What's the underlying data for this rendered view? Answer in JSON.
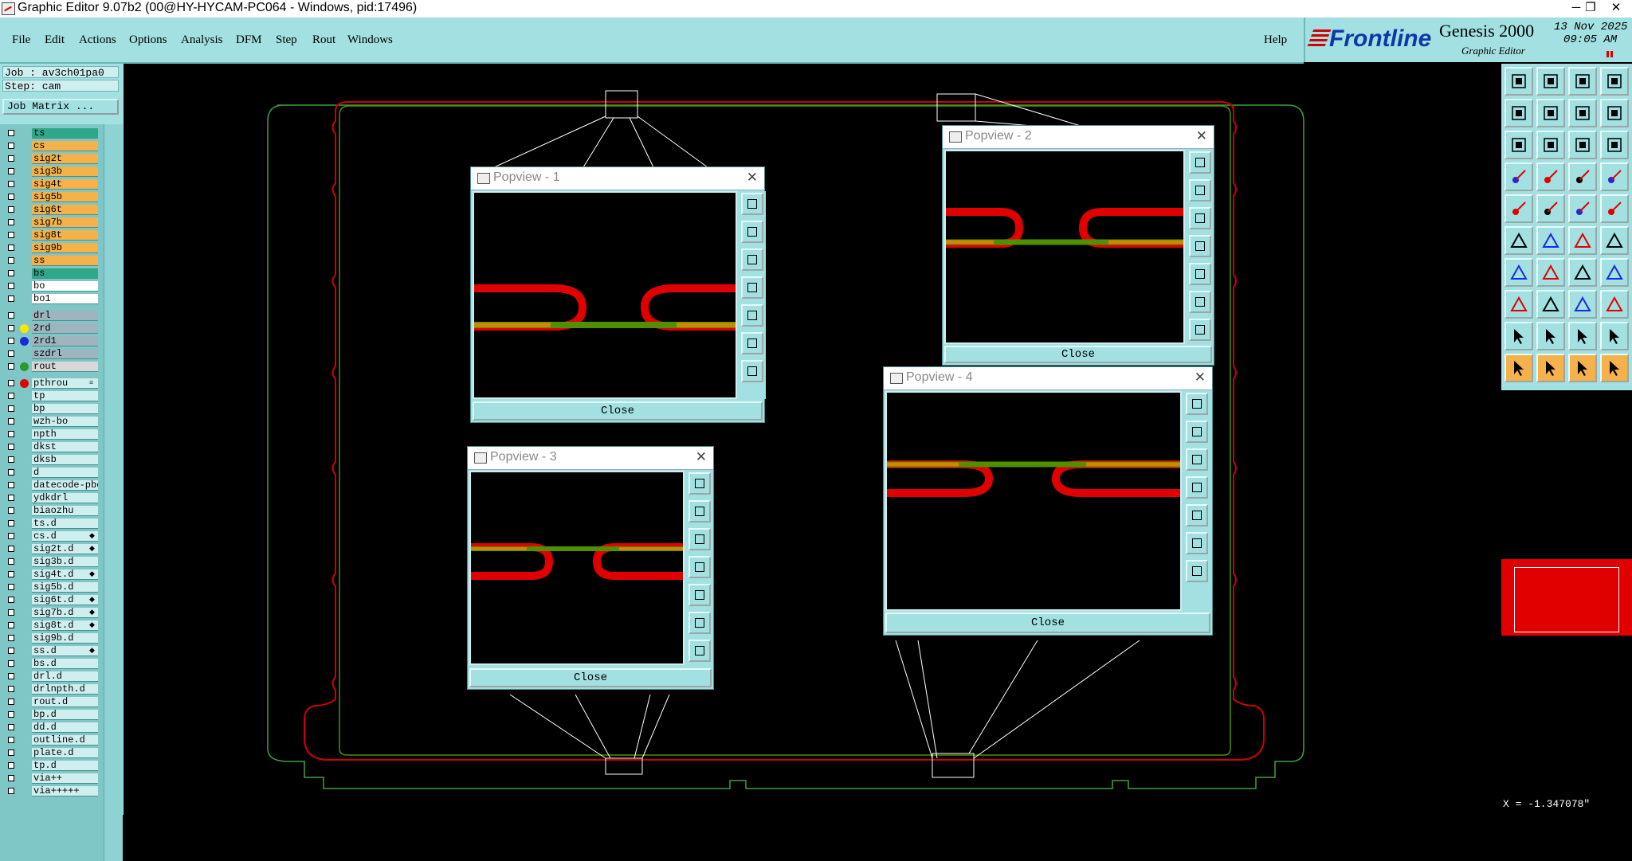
{
  "window": {
    "title": "Graphic Editor 9.07b2 (00@HY-HYCAM-PC064 - Windows, pid:17496)",
    "minimize": "─",
    "restore": "❐",
    "close": "✕"
  },
  "menu": {
    "items": [
      "File",
      "Edit",
      "Actions",
      "Options",
      "Analysis",
      "DFM",
      "Step",
      "Rout",
      "Windows"
    ],
    "help": "Help"
  },
  "brand": {
    "logo": "Frontline",
    "product": "Genesis 2000",
    "subtitle": "Graphic Editor",
    "date": "13 Nov 2025",
    "time": "09:05 AM"
  },
  "job": {
    "job_label": "Job : av3ch01pa0",
    "step_label": "Step: cam",
    "matrix_button": "Job Matrix ..."
  },
  "layers": [
    {
      "name": "ts",
      "bg": "#2fa888",
      "dot": ""
    },
    {
      "name": "cs",
      "bg": "#f5b24a",
      "dot": ""
    },
    {
      "name": "sig2t",
      "bg": "#f5b24a",
      "dot": ""
    },
    {
      "name": "sig3b",
      "bg": "#f5b24a",
      "dot": ""
    },
    {
      "name": "sig4t",
      "bg": "#f5b24a",
      "dot": ""
    },
    {
      "name": "sig5b",
      "bg": "#f5b24a",
      "dot": ""
    },
    {
      "name": "sig6t",
      "bg": "#f5b24a",
      "dot": ""
    },
    {
      "name": "sig7b",
      "bg": "#f5b24a",
      "dot": ""
    },
    {
      "name": "sig8t",
      "bg": "#f5b24a",
      "dot": ""
    },
    {
      "name": "sig9b",
      "bg": "#f5b24a",
      "dot": ""
    },
    {
      "name": "ss",
      "bg": "#f5b24a",
      "dot": ""
    },
    {
      "name": "bs",
      "bg": "#2fa888",
      "dot": ""
    },
    {
      "name": "bo",
      "bg": "#ffffff",
      "dot": ""
    },
    {
      "name": "bo1",
      "bg": "#ffffff",
      "dot": ""
    },
    {
      "name": "drl",
      "bg": "#9eb5bf",
      "dot": ""
    },
    {
      "name": "2rd",
      "bg": "#9eb5bf",
      "dot": "#ffe600"
    },
    {
      "name": "2rd1",
      "bg": "#9eb5bf",
      "dot": "#1a2ad8"
    },
    {
      "name": "szdrl",
      "bg": "#9eb5bf",
      "dot": ""
    },
    {
      "name": "rout",
      "bg": "#d8d8d8",
      "dot": "#2a9a2a"
    },
    {
      "name": "pthrou",
      "bg": "#cfeef0",
      "dot": "#e00000",
      "mark": "≡"
    },
    {
      "name": "tp",
      "bg": "#cfeef0",
      "dot": ""
    },
    {
      "name": "bp",
      "bg": "#cfeef0",
      "dot": ""
    },
    {
      "name": "wzh-bo",
      "bg": "#cfeef0",
      "dot": ""
    },
    {
      "name": "npth",
      "bg": "#cfeef0",
      "dot": ""
    },
    {
      "name": "dkst",
      "bg": "#cfeef0",
      "dot": ""
    },
    {
      "name": "dksb",
      "bg": "#cfeef0",
      "dot": ""
    },
    {
      "name": "d",
      "bg": "#cfeef0",
      "dot": ""
    },
    {
      "name": "datecode-pbo",
      "bg": "#cfeef0",
      "dot": ""
    },
    {
      "name": "ydkdrl",
      "bg": "#cfeef0",
      "dot": ""
    },
    {
      "name": "biaozhu",
      "bg": "#cfeef0",
      "dot": ""
    },
    {
      "name": "ts.d",
      "bg": "#cfeef0",
      "dot": ""
    },
    {
      "name": "cs.d",
      "bg": "#cfeef0",
      "dot": "",
      "mark": "◆"
    },
    {
      "name": "sig2t.d",
      "bg": "#cfeef0",
      "dot": "",
      "mark": "◆"
    },
    {
      "name": "sig3b.d",
      "bg": "#cfeef0",
      "dot": ""
    },
    {
      "name": "sig4t.d",
      "bg": "#cfeef0",
      "dot": "",
      "mark": "◆"
    },
    {
      "name": "sig5b.d",
      "bg": "#cfeef0",
      "dot": ""
    },
    {
      "name": "sig6t.d",
      "bg": "#cfeef0",
      "dot": "",
      "mark": "◆"
    },
    {
      "name": "sig7b.d",
      "bg": "#cfeef0",
      "dot": "",
      "mark": "◆"
    },
    {
      "name": "sig8t.d",
      "bg": "#cfeef0",
      "dot": "",
      "mark": "◆"
    },
    {
      "name": "sig9b.d",
      "bg": "#cfeef0",
      "dot": ""
    },
    {
      "name": "ss.d",
      "bg": "#cfeef0",
      "dot": "",
      "mark": "◆"
    },
    {
      "name": "bs.d",
      "bg": "#cfeef0",
      "dot": ""
    },
    {
      "name": "drl.d",
      "bg": "#cfeef0",
      "dot": ""
    },
    {
      "name": "drlnpth.d",
      "bg": "#cfeef0",
      "dot": ""
    },
    {
      "name": "rout.d",
      "bg": "#cfeef0",
      "dot": ""
    },
    {
      "name": "bp.d",
      "bg": "#cfeef0",
      "dot": ""
    },
    {
      "name": "dd.d",
      "bg": "#cfeef0",
      "dot": ""
    },
    {
      "name": "outline.d",
      "bg": "#cfeef0",
      "dot": ""
    },
    {
      "name": "plate.d",
      "bg": "#cfeef0",
      "dot": ""
    },
    {
      "name": "tp.d",
      "bg": "#cfeef0",
      "dot": ""
    },
    {
      "name": "via++",
      "bg": "#cfeef0",
      "dot": ""
    },
    {
      "name": "via+++++",
      "bg": "#cfeef0",
      "dot": ""
    }
  ],
  "popviews": [
    {
      "title": "Popview - 1",
      "close_label": "Close",
      "close_x": "✕"
    },
    {
      "title": "Popview - 2",
      "close_label": "Close",
      "close_x": "✕"
    },
    {
      "title": "Popview - 3",
      "close_label": "Close",
      "close_x": "✕"
    },
    {
      "title": "Popview - 4",
      "close_label": "Close",
      "close_x": "✕"
    }
  ],
  "tool_icons": [
    "open-job-icon",
    "save-icon",
    "home-icon",
    "window-layout-icon",
    "pan-left-icon",
    "pan-right-icon",
    "zoom-ratio-icon",
    "split-icon",
    "zoom-fit-icon",
    "zoom-center-icon",
    "scale-1-2-icon",
    "help-icon",
    "measure-icon",
    "pin-icon",
    "route-highlight-icon",
    "route-edit-icon",
    "pad-icon",
    "add-line-icon",
    "dash-line-icon",
    "round-pad-icon",
    "connect-nodes-icon",
    "cross-icon",
    "move-node-icon",
    "move-node2-icon",
    "angle-icon",
    "line-slope-icon",
    "rotate-icon",
    "stack-edit-icon",
    "node-select-icon",
    "minus-icon",
    "snap-icon",
    "multi-pad-icon",
    "triangle-icon",
    "arrow-up-icon",
    "trapezoid-icon",
    "trapezoid2-icon",
    "pointer-icon",
    "pointer-select-icon",
    "pointer-move-icon",
    "pointer-multi-icon"
  ],
  "colors": {
    "panel": "#a2e0e1",
    "trace_red": "#e00000",
    "trace_green": "#4f8f00",
    "trace_orange": "#c88a00",
    "outline_green": "#3fa03f"
  },
  "status": {
    "coord": "X = -1.347078\""
  }
}
